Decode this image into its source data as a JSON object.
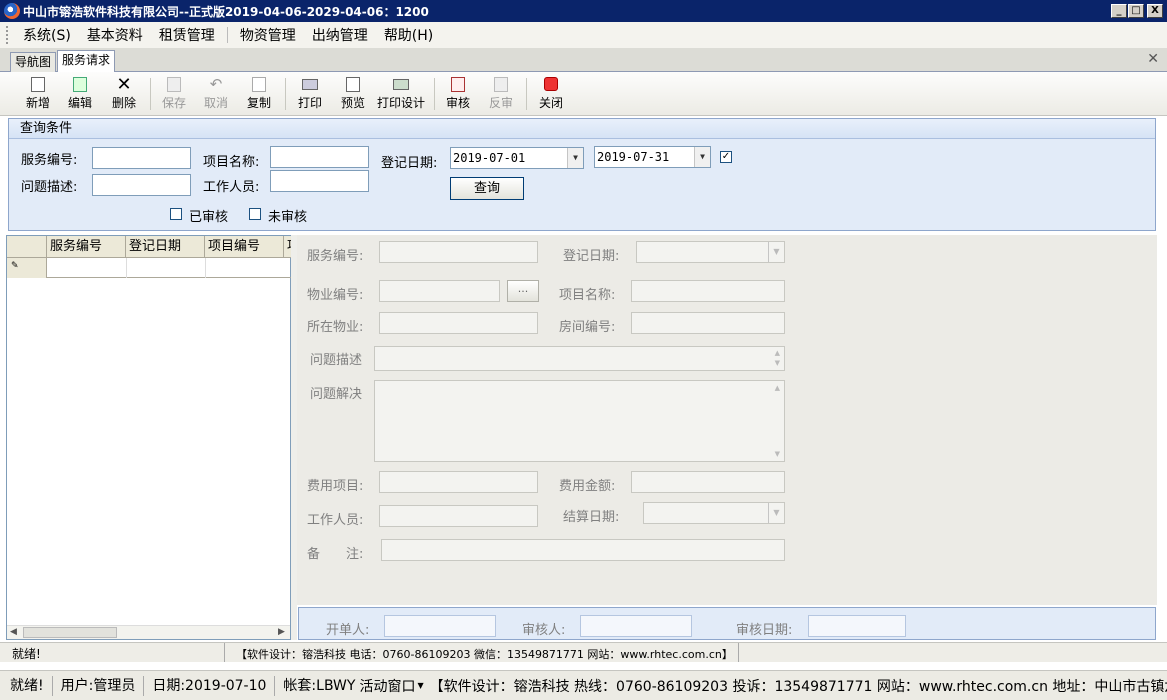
{
  "window": {
    "title": "中山市镕浩软件科技有限公司--正式版2019-04-06-2029-04-06：1200",
    "min": "_",
    "max": "□",
    "close": "X"
  },
  "menu": [
    "系统(S)",
    "基本资料",
    "租赁管理",
    "物资管理",
    "出纳管理",
    "帮助(H)"
  ],
  "tabs": [
    "导航图",
    "服务请求"
  ],
  "toolbar": {
    "new": "新增",
    "edit": "编辑",
    "delete": "删除",
    "save": "保存",
    "cancel": "取消",
    "copy": "复制",
    "print": "打印",
    "preview": "预览",
    "print_design": "打印设计",
    "audit": "审核",
    "unaudit": "反审",
    "close": "关闭"
  },
  "query": {
    "header": "查询条件",
    "service_no": "服务编号:",
    "project_name": "项目名称:",
    "reg_date": "登记日期:",
    "problem": "问题描述:",
    "worker": "工作人员:",
    "date_from": "2019-07-01",
    "date_to": "2019-07-31",
    "search": "查询",
    "audited": "已审核",
    "unaudited": "未审核"
  },
  "grid": {
    "columns": [
      "服务编号",
      "登记日期",
      "项目编号",
      "项"
    ]
  },
  "form": {
    "service_no": "服务编号:",
    "reg_date": "登记日期:",
    "property_no": "物业编号:",
    "browse": "...",
    "project_name": "项目名称:",
    "property": "所在物业:",
    "room_no": "房间编号:",
    "problem": "问题描述",
    "solution": "问题解决",
    "fee_item": "费用项目:",
    "fee_amount": "费用金额:",
    "worker": "工作人员:",
    "settle_date": "结算日期:",
    "note": "备　　注:"
  },
  "footer": {
    "creator": "开单人:",
    "auditor": "审核人:",
    "audit_date": "审核日期:"
  },
  "status_inner": {
    "ready": "就绪!",
    "info": "【软件设计：镕浩科技 电话：0760-86109203 微信：13549871771 网站：www.rhtec.com.cn】"
  },
  "statusbar": {
    "ready": "就绪!",
    "user": "用户:管理员",
    "date": "日期:2019-07-10",
    "account": "帐套:LBWY",
    "active": "活动窗口",
    "info": "【软件设计：镕浩科技 热线：0760-86109203 投诉：13549871771 网站：www.rhtec.com.cn 地址：中山市古镇六坊"
  }
}
